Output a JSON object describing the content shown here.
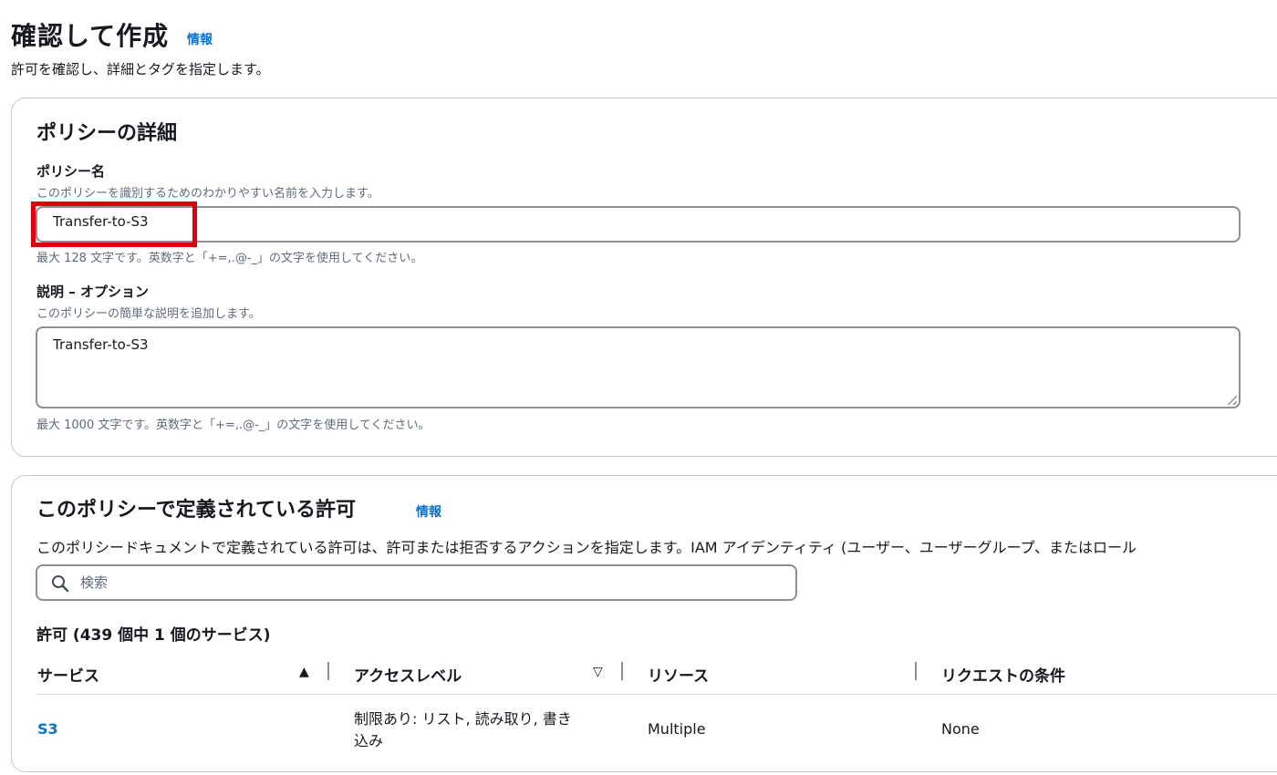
{
  "page": {
    "title": "確認して作成",
    "info_link": "情報",
    "description": "許可を確認し、詳細とタグを指定します。"
  },
  "policy_details": {
    "heading": "ポリシーの詳細",
    "name_label": "ポリシー名",
    "name_hint": "このポリシーを識別するためのわかりやすい名前を入力します。",
    "name_value": "Transfer-to-S3",
    "name_constraint": "最大 128 文字です。英数字と「+=,.@-_」の文字を使用してください。",
    "description_label": "説明 – オプション",
    "description_hint": "このポリシーの簡単な説明を追加します。",
    "description_value": "Transfer-to-S3",
    "description_constraint": "最大 1000 文字です。英数字と「+=,.@-_」の文字を使用してください。"
  },
  "permissions": {
    "heading": "このポリシーで定義されている許可",
    "info_link": "情報",
    "description": "このポリシードキュメントで定義されている許可は、許可または拒否するアクションを指定します。IAM アイデンティティ (ユーザー、ユーザーグループ、またはロール",
    "search_placeholder": "検索",
    "table_title": "許可 (439 個中 1 個のサービス)",
    "columns": [
      "サービス",
      "アクセスレベル",
      "リソース",
      "リクエストの条件"
    ],
    "rows": [
      {
        "service": "S3",
        "access_level_line1": "制限あり: リスト, 読み取り, 書き",
        "access_level_line2": "込み",
        "resource": "Multiple",
        "conditions": "None"
      }
    ]
  }
}
